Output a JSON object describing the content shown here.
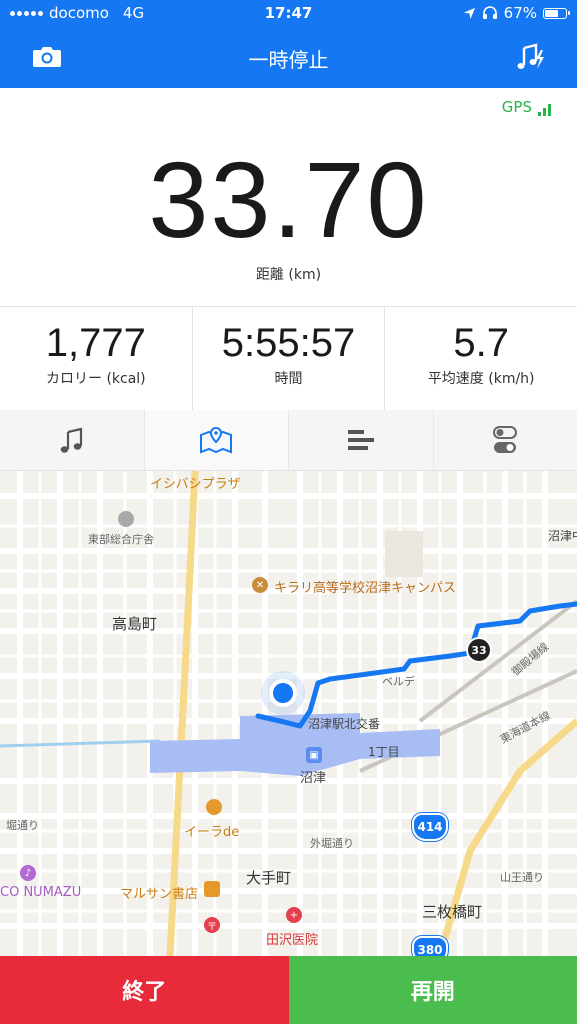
{
  "status_bar": {
    "carrier": "docomo",
    "network": "4G",
    "time": "17:47",
    "battery": "67%",
    "battery_level": 0.67
  },
  "header": {
    "title": "一時停止",
    "camera_icon": "camera-icon",
    "music_icon": "music-settings-icon"
  },
  "gps": {
    "label": "GPS"
  },
  "distance": {
    "value": "33.70",
    "label": "距離 (km)"
  },
  "stats": [
    {
      "value": "1,777",
      "label": "カロリー (kcal)"
    },
    {
      "value": "5:55:57",
      "label": "時間"
    },
    {
      "value": "5.7",
      "label": "平均速度 (km/h)"
    }
  ],
  "tabs": [
    {
      "icon": "music-note-icon"
    },
    {
      "icon": "map-icon",
      "active": true
    },
    {
      "icon": "splits-icon"
    },
    {
      "icon": "settings-toggle-icon"
    }
  ],
  "map": {
    "labels": {
      "ishibashi": "イシバシプラザ",
      "tobu": "東部総合庁舎",
      "kirari": "キラリ高等学校沼津キャンパス",
      "takashima": "高島町",
      "numazu_top": "沼津中",
      "gotenba": "御殿場線",
      "tokaido": "東海道本線",
      "velde": "ベルデ",
      "kitakoban": "沼津駅北交番",
      "chome": "1丁目",
      "numazu": "沼津",
      "horidori": "堀通り",
      "soto_horidori": "外堀通り",
      "ira": "イーラde",
      "route414": "414",
      "sanno": "山王通り",
      "co_numazu": "CO NUMAZU",
      "marusan": "マルサン書店",
      "otemachi": "大手町",
      "maibashi": "三枚橋町",
      "tazawa": "田沢医院",
      "route380": "380",
      "marker": "33"
    }
  },
  "actions": {
    "stop": "終了",
    "resume": "再開"
  },
  "colors": {
    "brand": "#1677f2",
    "stop": "#e72b3b",
    "resume": "#4bbd4f",
    "gps": "#2bb34a",
    "route": "#1677f2"
  }
}
